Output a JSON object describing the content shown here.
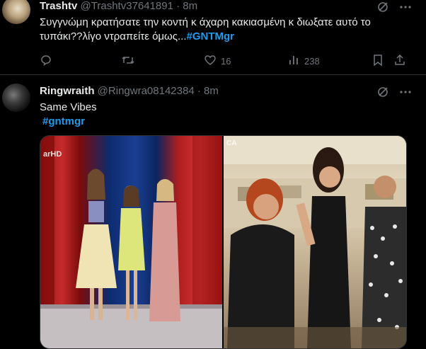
{
  "tweet1": {
    "name": "Trashtv",
    "handle": "@Trashtv37641891",
    "separator": "·",
    "time": "8m",
    "text": "Συγγνώμη κρατήσατε την κοντή κ άχαρη κακιασμένη κ διωξατε αυτό το τυπάκι??λίγο ντραπείτε όμως...",
    "hashtag": "#GNTMgr",
    "likes": "16",
    "views": "238"
  },
  "tweet2": {
    "name": "Ringwraith",
    "handle": "@Ringwra08142384",
    "separator": "·",
    "time": "8m",
    "text": "Same Vibes",
    "hashtag": "#gntmgr",
    "media_left_logo": "arHD",
    "media_right_logo": "CA"
  },
  "icons": {
    "grok": "grok-slash-icon",
    "more": "more-dots-icon",
    "reply": "reply-bubble-icon",
    "retweet": "retweet-icon",
    "like": "heart-icon",
    "views": "views-bar-icon",
    "bookmark": "bookmark-icon",
    "share": "share-upload-icon"
  },
  "colors": {
    "background": "#000000",
    "text": "#e7e9ea",
    "muted": "#71767b",
    "accent": "#1d9bf0",
    "divider": "#2f3336"
  }
}
